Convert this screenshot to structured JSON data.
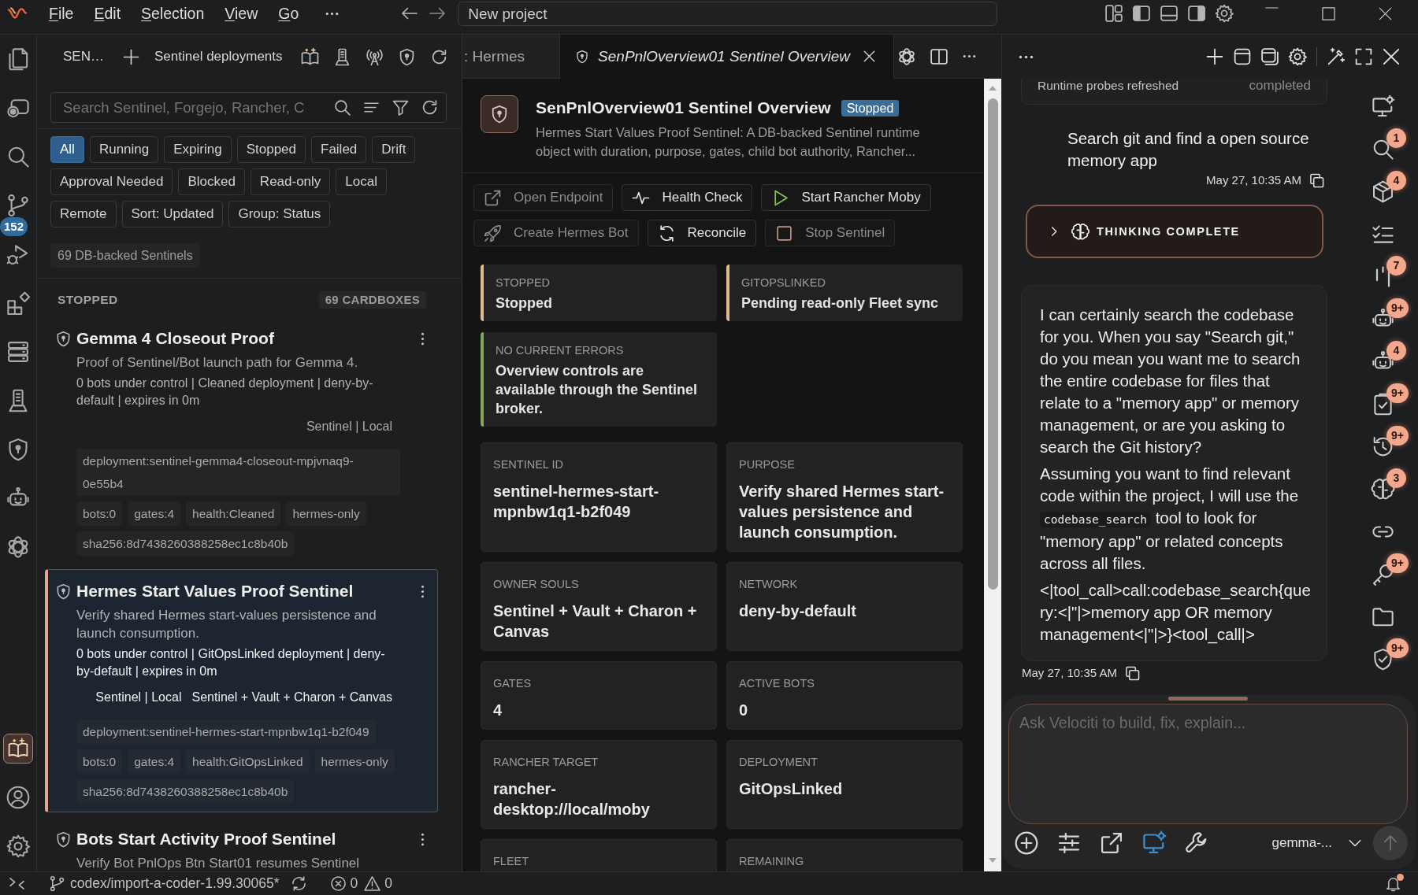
{
  "title_bar": {
    "menu": [
      "File",
      "Edit",
      "Selection",
      "View",
      "Go"
    ],
    "command_center": "New project",
    "layout": {
      "primary_sidebar": true,
      "panel": false,
      "secondary_sidebar": true
    }
  },
  "activity_bar": {
    "items": [
      {
        "selected": false
      },
      {
        "selected": false
      },
      {
        "selected": false
      },
      {
        "selected": false,
        "badge": "152"
      },
      {
        "selected": false
      },
      {
        "selected": false
      },
      {
        "selected": false
      },
      {
        "selected": false
      },
      {
        "selected": false
      },
      {
        "selected": false
      },
      {
        "selected": false
      }
    ],
    "bottom_items": [
      {
        "selected": true
      },
      {
        "selected": false
      },
      {
        "selected": false
      }
    ]
  },
  "sidebar": {
    "title": "SEN…",
    "view_title": "Sentinel deployments",
    "search": {
      "placeholder": "Search Sentinel, Forgejo, Rancher, C"
    },
    "filters": [
      {
        "label": "All",
        "selected": true
      },
      {
        "label": "Running",
        "selected": false
      },
      {
        "label": "Expiring",
        "selected": false
      },
      {
        "label": "Stopped",
        "selected": false
      },
      {
        "label": "Failed",
        "selected": false
      },
      {
        "label": "Drift",
        "selected": false
      },
      {
        "label": "Approval Needed",
        "selected": false
      },
      {
        "label": "Blocked",
        "selected": false
      },
      {
        "label": "Read-only",
        "selected": false
      },
      {
        "label": "Local",
        "selected": false
      },
      {
        "label": "Remote",
        "selected": false
      },
      {
        "label": "Sort: Updated",
        "selected": false
      },
      {
        "label": "Group: Status",
        "selected": false
      }
    ],
    "summary": "69 DB-backed Sentinels",
    "group": {
      "title": "STOPPED",
      "count": "69 CARDBOXES"
    },
    "cards": [
      {
        "title": "Gemma 4 Closeout Proof",
        "description": "Proof of Sentinel/Bot launch path for Gemma 4.",
        "meta": "0 bots under control | Cleaned deployment | deny-by-default | expires in 0m",
        "labels": [
          "Sentinel | Local"
        ],
        "chips": [
          "deployment:sentinel-gemma4-closeout-mpjvnaq9-0e55b4",
          "bots:0",
          "gates:4",
          "health:Cleaned",
          "hermes-only",
          "sha256:8d7438260388258ec1c8b40b"
        ],
        "selected": false
      },
      {
        "title": "Hermes Start Values Proof Sentinel",
        "description": "Verify shared Hermes start-values persistence and launch consumption.",
        "meta": "0 bots under control | GitOpsLinked deployment | deny-by-default | expires in 0m",
        "labels": [
          "Sentinel | Local",
          "Sentinel + Vault + Charon + Canvas"
        ],
        "chips": [
          "deployment:sentinel-hermes-start-mpnbw1q1-b2f049",
          "bots:0",
          "gates:4",
          "health:GitOpsLinked",
          "hermes-only",
          "sha256:8d7438260388258ec1c8b40b"
        ],
        "selected": true
      },
      {
        "title": "Bots Start Activity Proof Sentinel",
        "description": "Verify Bot PnlOps Btn Start01 resumes Sentinel",
        "selected": false
      }
    ]
  },
  "editor": {
    "tabs": [
      {
        "label": ": Hermes",
        "selected": false,
        "preview": false
      },
      {
        "label": "SenPnlOverview01 Sentinel Overview",
        "selected": true,
        "preview": true
      }
    ],
    "overview": {
      "title": "SenPnlOverview01 Sentinel Overview",
      "status": "Stopped",
      "description": "Hermes Start Values Proof Sentinel: A DB-backed Sentinel runtime object with duration, purpose, gates, child bot authority, Rancher...",
      "actions": [
        {
          "label": "Open Endpoint",
          "disabled": true
        },
        {
          "label": "Health Check",
          "disabled": false
        },
        {
          "label": "Start Rancher Moby",
          "disabled": false
        },
        {
          "label": "Create Hermes Bot",
          "disabled": true
        },
        {
          "label": "Reconcile",
          "disabled": false
        },
        {
          "label": "Stop Sentinel",
          "disabled": true
        }
      ],
      "alerts": [
        {
          "label": "STOPPED",
          "value": "Stopped",
          "color": "#e2b98e"
        },
        {
          "label": "GITOPSLINKED",
          "value": "Pending read-only Fleet sync",
          "color": "#e2b98e"
        },
        {
          "label": "NO CURRENT ERRORS",
          "value": "Overview controls are available through the Sentinel broker.",
          "color": "#7fa85a"
        }
      ],
      "fields": [
        {
          "label": "SENTINEL ID",
          "value": "sentinel-hermes-start-mpnbw1q1-b2f049"
        },
        {
          "label": "PURPOSE",
          "value": "Verify shared Hermes start-values persistence and launch consumption."
        },
        {
          "label": "OWNER SOULS",
          "value": "Sentinel + Vault + Charon + Canvas"
        },
        {
          "label": "NETWORK",
          "value": "deny-by-default"
        },
        {
          "label": "GATES",
          "value": "4"
        },
        {
          "label": "ACTIVE BOTS",
          "value": "0"
        },
        {
          "label": "RANCHER TARGET",
          "value": "rancher-desktop://local/moby"
        },
        {
          "label": "DEPLOYMENT",
          "value": "GitOpsLinked"
        },
        {
          "label": "FLEET"
        },
        {
          "label": "REMAINING"
        }
      ]
    }
  },
  "chat": {
    "messages": [
      {
        "kind": "activity",
        "text": "Runtime probes refreshed",
        "status": "completed"
      },
      {
        "kind": "user",
        "text": "Search git and find a open source memory app",
        "time": "May 27, 10:35 AM"
      },
      {
        "kind": "thinking",
        "label": "THINKING COMPLETE",
        "expanded": false
      },
      {
        "kind": "assistant",
        "paragraphs": [
          {
            "segments": [
              {
                "kind": "text",
                "text": "I can certainly search the codebase for you. When you say \"Search git,\" do you mean you want me to search the entire codebase for files that relate to a \"memory app\" or memory management, or are you asking to search the Git history?"
              }
            ]
          },
          {
            "segments": [
              {
                "kind": "text",
                "text": "Assuming you want to find relevant code within the project, I will use the "
              },
              {
                "kind": "code",
                "text": "codebase_search"
              },
              {
                "kind": "text",
                "text": " tool to look for \"memory app\" or related concepts across all files."
              }
            ]
          },
          {
            "segments": [
              {
                "kind": "text",
                "text": "<|tool_call>call:codebase_search{query:<|\"|>memory app OR memory management<|\"|>}<tool_call|>"
              }
            ]
          }
        ],
        "time": "May 27, 10:35 AM"
      }
    ],
    "composer": {
      "placeholder": "Ask Velociti to build, fix, explain...",
      "tools": [
        {
          "active": false
        },
        {
          "active": false
        },
        {
          "active": false
        },
        {
          "active": true
        },
        {
          "active": false
        }
      ],
      "model": "gemma-..."
    }
  },
  "secondary_bar": {
    "items": [
      {
        "selected": false
      },
      {
        "selected": false,
        "badge": "1"
      },
      {
        "selected": false,
        "badge": "4"
      },
      {
        "selected": false
      },
      {
        "selected": false,
        "badge": "7"
      },
      {
        "selected": false,
        "badge": "9+"
      },
      {
        "selected": false,
        "badge": "4"
      },
      {
        "selected": false,
        "badge": "9+"
      },
      {
        "selected": false,
        "badge": "9+"
      },
      {
        "selected": false,
        "badge": "3"
      },
      {
        "selected": false
      },
      {
        "selected": false,
        "badge": "9+"
      },
      {
        "selected": false
      },
      {
        "selected": false,
        "badge": "9+"
      }
    ]
  },
  "status_bar": {
    "branch": "codex/import-a-coder-1.99.30065*",
    "errors": "0",
    "warnings": "0",
    "notifications_unread": true
  }
}
